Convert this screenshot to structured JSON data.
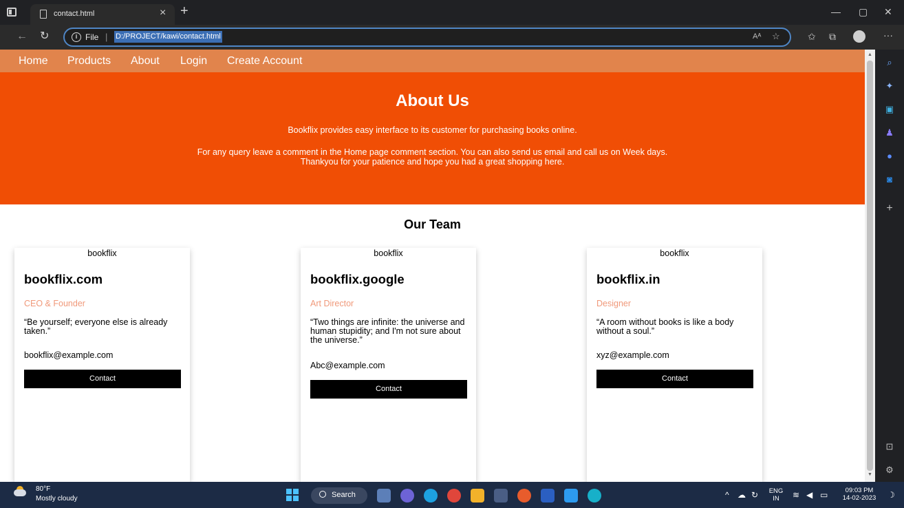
{
  "browser": {
    "tab_title": "contact.html",
    "tab_close": "×",
    "new_tab": "+",
    "file_label": "File",
    "separator": "|",
    "url": "D:/PROJECT/kawi/contact.html",
    "read_aloud": "Aᴬ",
    "favorite": "☆"
  },
  "site_nav": {
    "items": [
      "Home",
      "Products",
      "About",
      "Login",
      "Create Account"
    ]
  },
  "about": {
    "title": "About Us",
    "line1": "Bookflix provides easy interface to its customer for purchasing books online.",
    "line2": "For any query leave a comment in the Home page comment section. You can also send us email and call us on Week days.",
    "line3": "Thankyou for your patience and hope you had a great shopping here."
  },
  "team": {
    "title": "Our Team",
    "members": [
      {
        "img_alt": "bookflix",
        "name": "bookflix.com",
        "role": "CEO & Founder",
        "quote": "“Be yourself; everyone else is already taken.”",
        "email": "bookflix@example.com",
        "button": "Contact"
      },
      {
        "img_alt": "bookflix",
        "name": "bookflix.google",
        "role": "Art Director",
        "quote": "“Two things are infinite: the universe and human stupidity; and I'm not sure about the universe.”",
        "email": "Abc@example.com",
        "button": "Contact"
      },
      {
        "img_alt": "bookflix",
        "name": "bookflix.in",
        "role": "Designer",
        "quote": "“A room without books is like a body without a soul.”",
        "email": "xyz@example.com",
        "button": "Contact"
      }
    ]
  },
  "taskbar": {
    "temperature": "80°F",
    "weather": "Mostly cloudy",
    "search": "Search",
    "lang_top": "ENG",
    "lang_bottom": "IN",
    "time": "09:03 PM",
    "date": "14-02-2023"
  },
  "colors": {
    "nav_bar": "#e1844c",
    "about_bg": "#f04e05",
    "role_text": "#f0997a",
    "button_bg": "#000000"
  }
}
